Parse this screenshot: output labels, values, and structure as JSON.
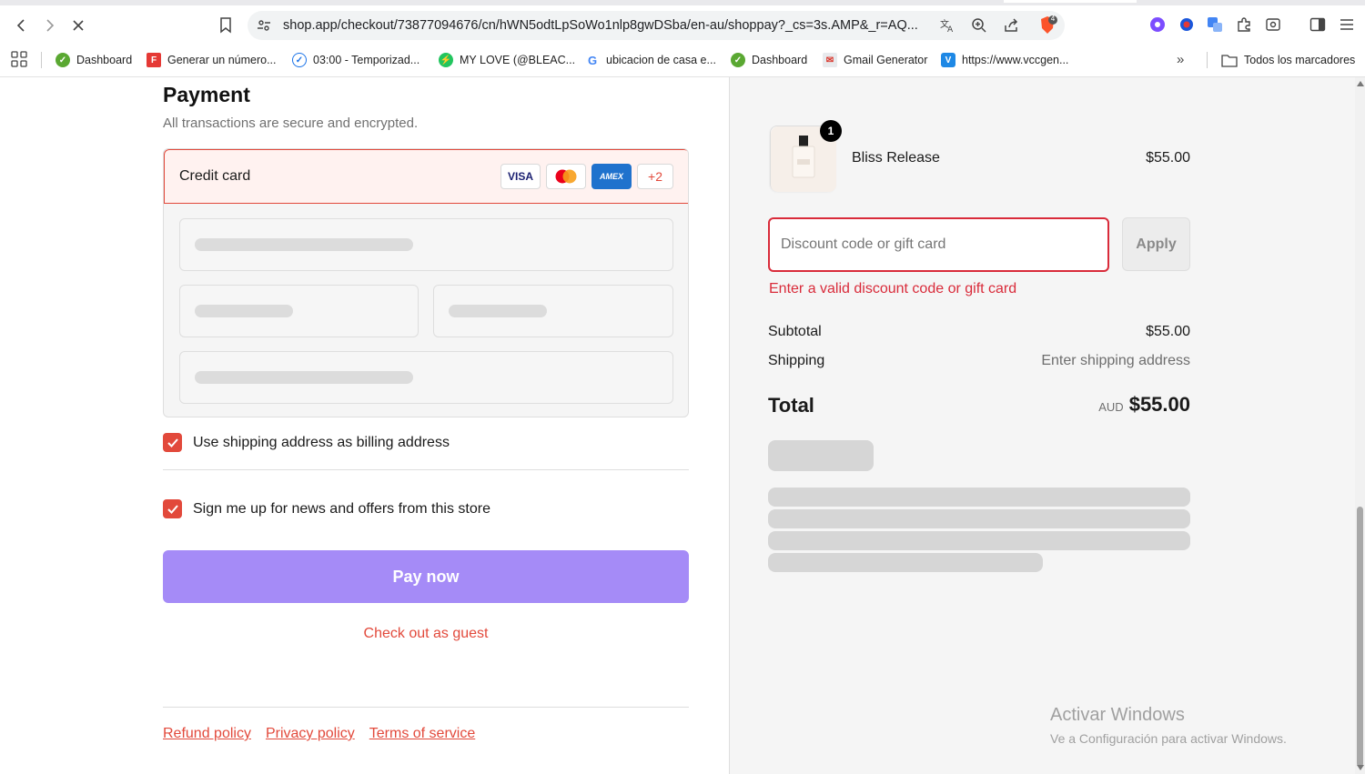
{
  "browser": {
    "url": "shop.app/checkout/73877094676/cn/hWN5odtLpSoWo1nlp8gwDSba/en-au/shoppay?_cs=3s.AMP&_r=AQ...",
    "extension_badge_count": "4",
    "bookmarks": [
      {
        "label": "Dashboard",
        "icon": "dashboard-icon",
        "color": "#5aa832"
      },
      {
        "label": "Generar un número...",
        "icon": "f-icon",
        "color": "#e53935"
      },
      {
        "label": "03:00 - Temporizad...",
        "icon": "check-clock-icon",
        "color": "#1a73e8"
      },
      {
        "label": "MY LOVE (@BLEAC...",
        "icon": "bolt-icon",
        "color": "#22c55e"
      },
      {
        "label": "ubicacion de casa e...",
        "icon": "google-icon",
        "color": "#4285f4"
      },
      {
        "label": "Dashboard",
        "icon": "dashboard-icon",
        "color": "#5aa832"
      },
      {
        "label": "Gmail Generator",
        "icon": "gmail-icon",
        "color": "#555555"
      },
      {
        "label": "https://www.vccgen...",
        "icon": "v-icon",
        "color": "#1e88e5"
      }
    ],
    "all_bookmarks_label": "Todos los marcadores"
  },
  "payment": {
    "title": "Payment",
    "subtitle": "All transactions are secure and encrypted.",
    "method_label": "Credit card",
    "card_brands": [
      "VISA",
      "mastercard",
      "AMEX",
      "+2"
    ],
    "billing_checkbox_label": "Use shipping address as billing address",
    "billing_checked": true,
    "news_checkbox_label": "Sign me up for news and offers from this store",
    "news_checked": true,
    "pay_button_label": "Pay now",
    "guest_link_label": "Check out as guest",
    "footer_links": [
      "Refund policy",
      "Privacy policy",
      "Terms of service"
    ]
  },
  "order": {
    "product_name": "Bliss Release",
    "product_price": "$55.00",
    "product_quantity": "1",
    "discount_placeholder": "Discount code or gift card",
    "apply_label": "Apply",
    "discount_error": "Enter a valid discount code or gift card",
    "subtotal_label": "Subtotal",
    "subtotal_value": "$55.00",
    "shipping_label": "Shipping",
    "shipping_value": "Enter shipping address",
    "total_label": "Total",
    "total_currency": "AUD",
    "total_value": "$55.00"
  },
  "watermark": {
    "line1": "Activar Windows",
    "line2": "Ve a Configuración para activar Windows."
  },
  "colors": {
    "accent": "#e2493b",
    "pay_button": "#a58bf7",
    "error": "#d92b3a"
  }
}
